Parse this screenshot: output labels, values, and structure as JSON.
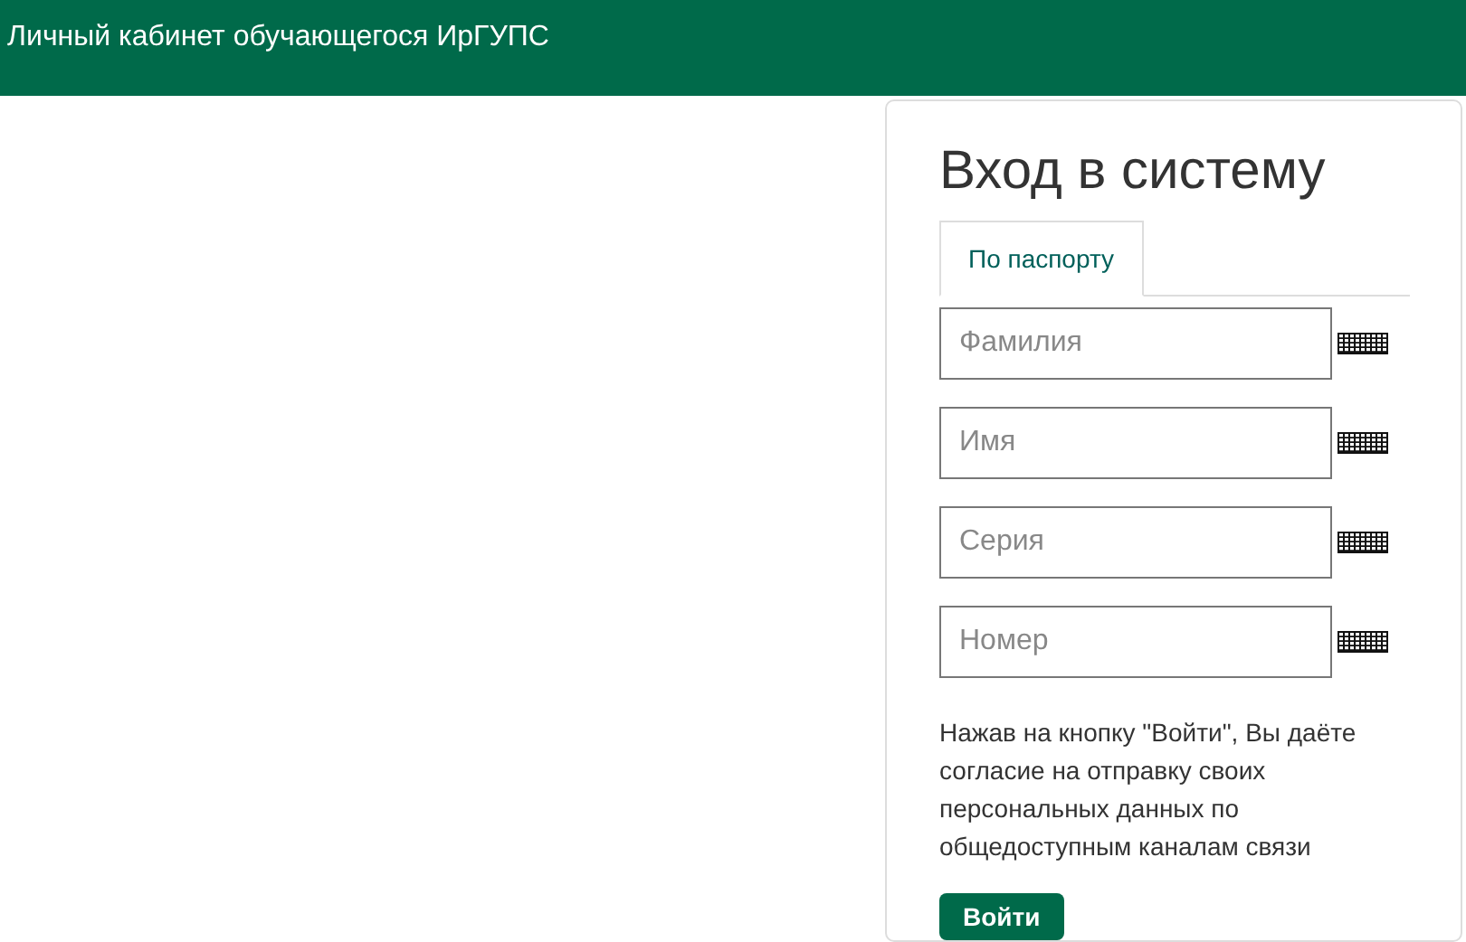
{
  "header": {
    "title": "Личный кабинет обучающегося ИрГУПС"
  },
  "login": {
    "title": "Вход в систему",
    "tabs": [
      {
        "label": "По паспорту",
        "selected": true
      }
    ],
    "fields": [
      {
        "placeholder": "Фамилия"
      },
      {
        "placeholder": "Имя"
      },
      {
        "placeholder": "Серия"
      },
      {
        "placeholder": "Номер"
      }
    ],
    "consent": "Нажав на кнопку \"Войти\", Вы даёте согласие на отправку своих персональных данных по общедоступным каналам связи",
    "submit": "Войти"
  }
}
